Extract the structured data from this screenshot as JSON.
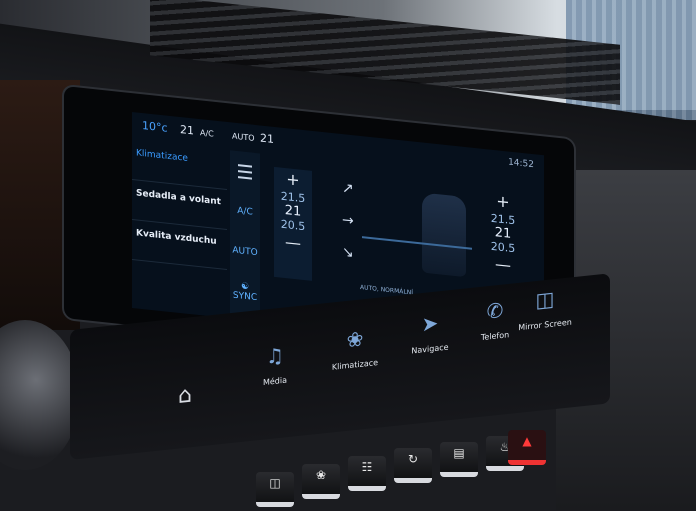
{
  "status": {
    "outside_temp": "10°c",
    "driver_temp": "21",
    "ac": "A/C",
    "auto": "AUTO",
    "passenger_temp": "21",
    "time": "14:52"
  },
  "menu": {
    "items": [
      {
        "label": "Klimatizace"
      },
      {
        "label": "Sedadla a volant"
      },
      {
        "label": "Kvalita vzduchu"
      }
    ]
  },
  "controls": {
    "ac_label": "A/C",
    "auto_label": "AUTO",
    "sync_label": "SYNC"
  },
  "temps": {
    "left": {
      "up": "21.5",
      "current": "21",
      "down": "20.5"
    },
    "right": {
      "up": "21.5",
      "current": "21",
      "down": "20.5"
    }
  },
  "airflow": {
    "mode_label": "AUTO, NORMÁLNÍ"
  },
  "shortcuts": [
    {
      "label": "Média",
      "icon": "music-note-icon"
    },
    {
      "label": "Klimatizace",
      "icon": "fan-icon"
    },
    {
      "label": "Navigace",
      "icon": "navigation-icon"
    },
    {
      "label": "Telefon",
      "icon": "phone-icon"
    },
    {
      "label": "Mirror Screen",
      "icon": "mirror-screen-icon"
    }
  ],
  "colors": {
    "accent": "#3a9bff",
    "hazard": "#ff3a3a"
  }
}
